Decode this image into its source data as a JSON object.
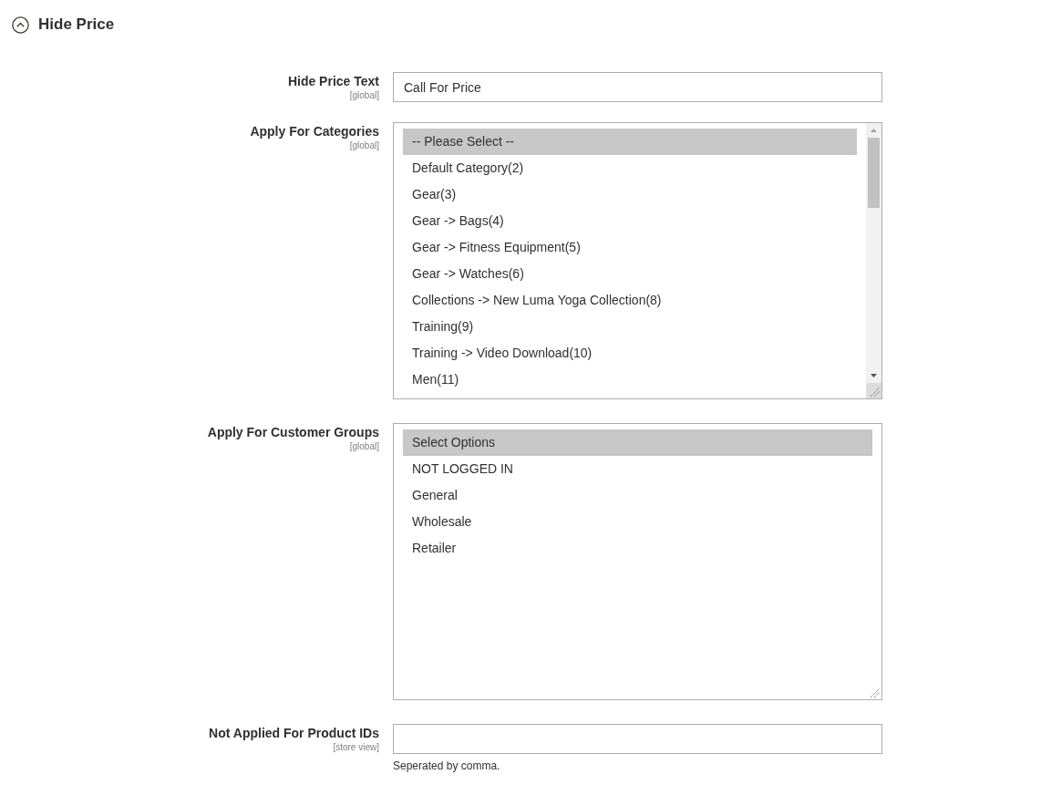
{
  "section": {
    "title": "Hide Price",
    "expanded": true
  },
  "fields": [
    {
      "kind": "text",
      "label": "Hide Price Text",
      "scope": "[global]",
      "value": "Call For Price"
    },
    {
      "kind": "multiselect",
      "label": "Apply For Categories",
      "scope": "[global]",
      "scrollable": true,
      "options": [
        {
          "label": "-- Please Select --",
          "selected": true
        },
        {
          "label": "Default Category(2)",
          "selected": false
        },
        {
          "label": "Gear(3)",
          "selected": false
        },
        {
          "label": "Gear -> Bags(4)",
          "selected": false
        },
        {
          "label": "Gear -> Fitness Equipment(5)",
          "selected": false
        },
        {
          "label": "Gear -> Watches(6)",
          "selected": false
        },
        {
          "label": "Collections -> New Luma Yoga Collection(8)",
          "selected": false
        },
        {
          "label": "Training(9)",
          "selected": false
        },
        {
          "label": "Training -> Video Download(10)",
          "selected": false
        },
        {
          "label": "Men(11)",
          "selected": false
        }
      ]
    },
    {
      "kind": "multiselect",
      "label": "Apply For Customer Groups",
      "scope": "[global]",
      "scrollable": false,
      "options": [
        {
          "label": "Select Options",
          "selected": true
        },
        {
          "label": "NOT LOGGED IN",
          "selected": false
        },
        {
          "label": "General",
          "selected": false
        },
        {
          "label": "Wholesale",
          "selected": false
        },
        {
          "label": "Retailer",
          "selected": false
        }
      ]
    },
    {
      "kind": "text",
      "label": "Not Applied For Product IDs",
      "scope": "[store view]",
      "note": "Seperated by comma."
    }
  ]
}
